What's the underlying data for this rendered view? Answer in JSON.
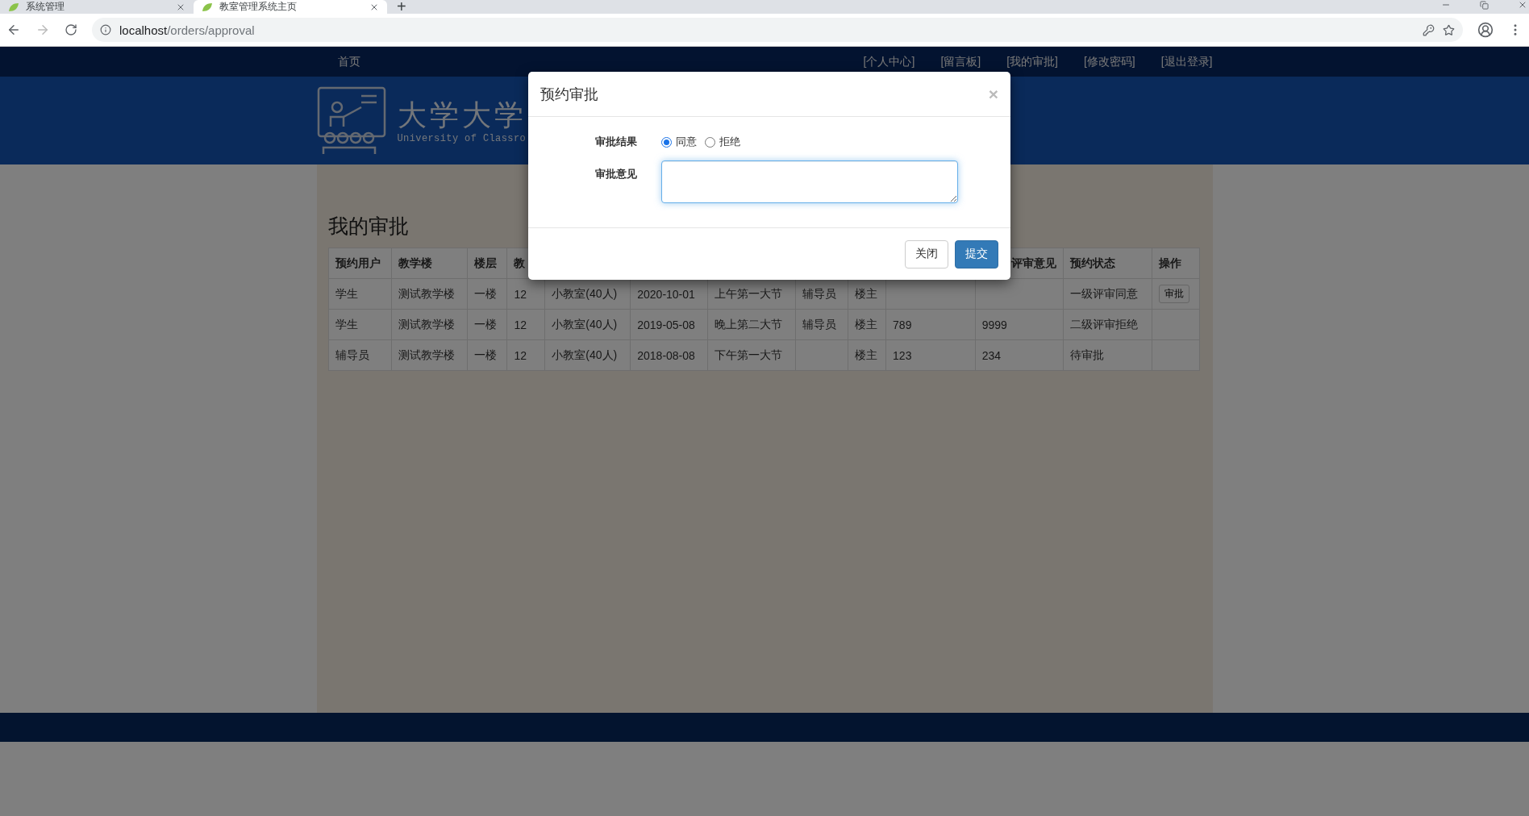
{
  "browser": {
    "tabs": [
      {
        "title": "系统管理",
        "selected": false
      },
      {
        "title": "教室管理系统主页",
        "selected": true
      }
    ],
    "new_tab": "+",
    "address": {
      "host": "localhost",
      "path": "/orders/approval"
    }
  },
  "nav": {
    "home": "首页",
    "links": [
      "[个人中心]",
      "[留言板]",
      "[我的审批]",
      "[修改密码]",
      "[退出登录]"
    ]
  },
  "banner": {
    "title": "大学大学",
    "subtitle": "University of Classro"
  },
  "page": {
    "heading": "我的审批",
    "table": {
      "columns": [
        "预约用户",
        "教学楼",
        "楼层",
        "教",
        null,
        null,
        null,
        null,
        null,
        null,
        "评审意见",
        "预约状态",
        "操作"
      ],
      "rows": [
        {
          "cells": [
            "学生",
            "测试教学楼",
            "一楼",
            "12",
            "小教室(40人)",
            "2020-10-01",
            "上午第一大节",
            "辅导员",
            "楼主",
            null,
            null,
            "一级评审同意"
          ],
          "action": "审批"
        },
        {
          "cells": [
            "学生",
            "测试教学楼",
            "一楼",
            "12",
            "小教室(40人)",
            "2019-05-08",
            "晚上第二大节",
            "辅导员",
            "楼主",
            "789",
            "9999",
            "二级评审拒绝"
          ]
        },
        {
          "cells": [
            "辅导员",
            "测试教学楼",
            "一楼",
            "12",
            "小教室(40人)",
            "2018-08-08",
            "下午第一大节",
            null,
            "楼主",
            "123",
            "234",
            "待审批"
          ]
        }
      ]
    }
  },
  "modal": {
    "title": "预约审批",
    "close": "×",
    "result": {
      "label": "审批结果",
      "options": [
        {
          "label": "同意",
          "selected": true
        },
        {
          "label": "拒绝",
          "selected": false
        }
      ]
    },
    "opinion": {
      "label": "审批意见",
      "focused": true
    },
    "buttons": [
      {
        "label": "关闭",
        "kind": "default"
      },
      {
        "label": "提交",
        "kind": "primary"
      }
    ]
  }
}
